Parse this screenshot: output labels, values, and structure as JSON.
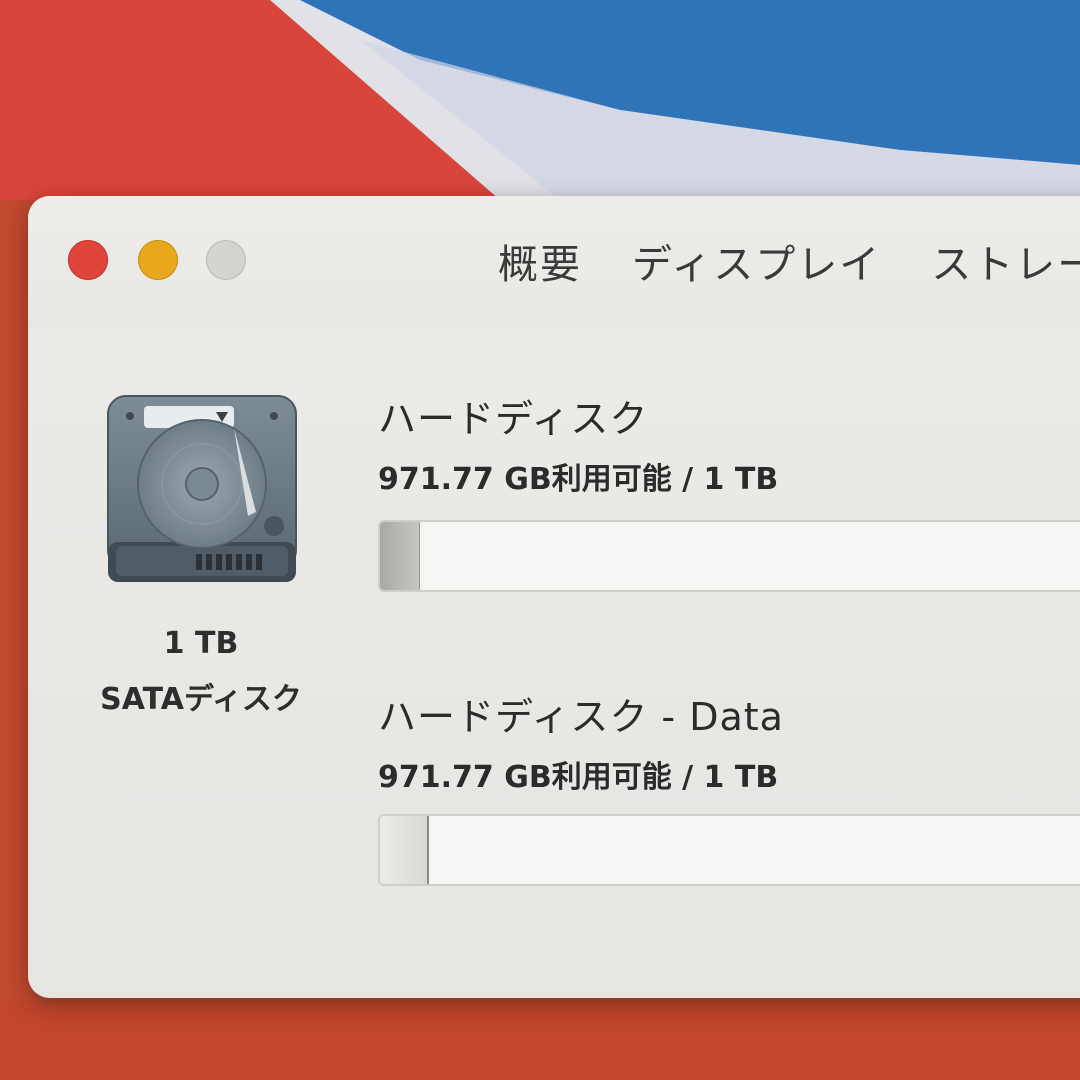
{
  "window": {
    "tabs": [
      {
        "label": "概要"
      },
      {
        "label": "ディスプレイ"
      },
      {
        "label": "ストレー"
      }
    ]
  },
  "disk": {
    "icon": "hard-drive-icon",
    "capacity": "1 TB",
    "type": "SATAディスク"
  },
  "volumes": [
    {
      "name": "ハードディスク",
      "info": "971.77 GB利用可能 / 1 TB",
      "used_fraction": 0.05
    },
    {
      "name": "ハードディスク - Data",
      "info": "971.77 GB利用可能 / 1 TB",
      "used_fraction": 0.06
    }
  ],
  "colors": {
    "close": "#e0443a",
    "minimize": "#e8a81e",
    "zoom": "#d4d3d0",
    "wallpaper_red": "#c0492e",
    "wallpaper_blue": "#2f73b8"
  }
}
